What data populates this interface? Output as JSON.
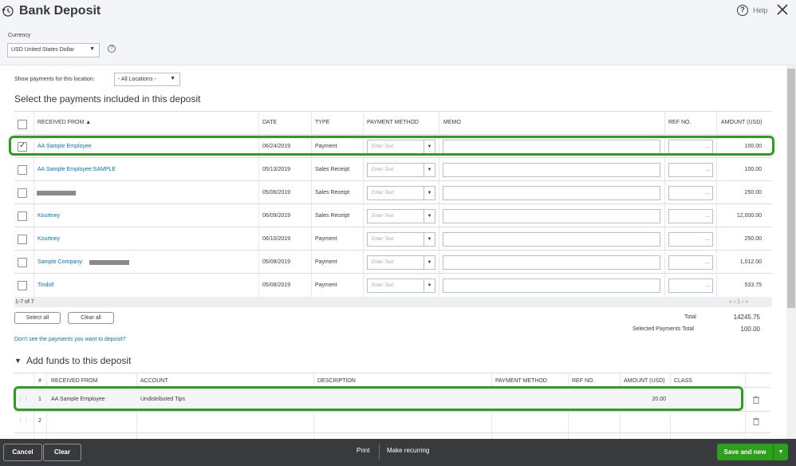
{
  "header": {
    "title": "Bank Deposit",
    "help_label": "Help",
    "currency_label": "Currency",
    "currency_value": "USD United States Dollar"
  },
  "location": {
    "label": "Show payments for this location:",
    "value": "- All Locations -"
  },
  "payments": {
    "section_title": "Select the payments included in this deposit",
    "columns": {
      "received_from": "RECEIVED FROM ▲",
      "date": "DATE",
      "type": "TYPE",
      "payment_method": "PAYMENT METHOD",
      "memo": "MEMO",
      "ref_no": "REF NO.",
      "amount": "AMOUNT (USD)"
    },
    "method_placeholder": "Enter Text",
    "rows": [
      {
        "received_from": "AA Sample Employee",
        "date": "06/24/2019",
        "type": "Payment",
        "amount": "100.00",
        "checked": true
      },
      {
        "received_from": "AA Sample Employee:SAMPLE",
        "date": "05/13/2019",
        "type": "Sales Receipt",
        "amount": "100.00",
        "checked": false
      },
      {
        "received_from": "",
        "date": "05/06/2019",
        "type": "Sales Receipt",
        "amount": "250.00",
        "checked": false
      },
      {
        "received_from": "Kourtney",
        "date": "06/09/2019",
        "type": "Sales Receipt",
        "amount": "12,000.00",
        "checked": false
      },
      {
        "received_from": "Kourtney",
        "date": "06/10/2019",
        "type": "Payment",
        "amount": "250.00",
        "checked": false
      },
      {
        "received_from": "Sample Company:",
        "date": "05/08/2019",
        "type": "Payment",
        "amount": "1,012.00",
        "checked": false
      },
      {
        "received_from": "Tindoll",
        "date": "05/06/2019",
        "type": "Payment",
        "amount": "533.75",
        "checked": false
      }
    ],
    "pager": "1-7 of 7",
    "pager_nav": "« ‹ 1 › »",
    "select_all": "Select all",
    "clear_all": "Clear all",
    "total_label": "Total",
    "total_value": "14245.75",
    "selected_label": "Selected Payments Total",
    "selected_value": "100.00",
    "missing_link": "Don't see the payments you want to deposit?"
  },
  "funds": {
    "section_title": "Add funds to this deposit",
    "columns": {
      "num": "#",
      "received_from": "RECEIVED FROM",
      "account": "ACCOUNT",
      "description": "DESCRIPTION",
      "payment_method": "PAYMENT METHOD",
      "ref_no": "REF NO.",
      "amount": "AMOUNT (USD)",
      "class": "CLASS"
    },
    "rows": [
      {
        "num": "1",
        "received_from": "AA Sample Employee",
        "account": "Undistributed Tips",
        "amount": "20.00"
      },
      {
        "num": "2",
        "received_from": "",
        "account": "",
        "amount": ""
      }
    ]
  },
  "footer": {
    "cancel": "Cancel",
    "clear": "Clear",
    "print": "Print",
    "make_recurring": "Make recurring",
    "save_new": "Save and new"
  },
  "colors": {
    "accent_green": "#2ca01c",
    "link_blue": "#0077c5",
    "bar_dark": "#393a3d"
  }
}
